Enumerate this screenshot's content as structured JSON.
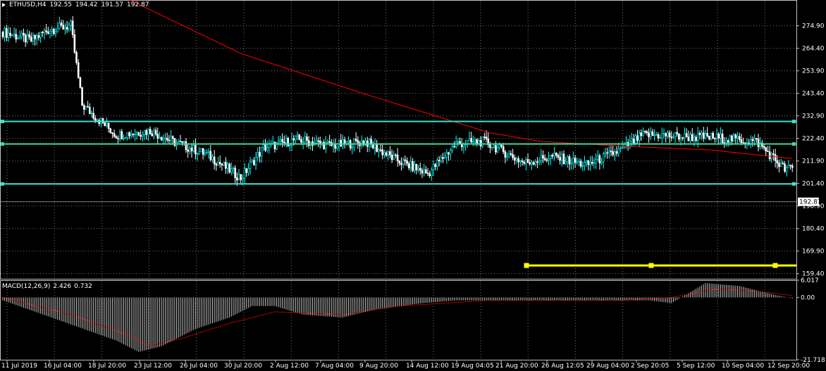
{
  "header": {
    "symbol": "ETHUSD,H4",
    "open": "192.55",
    "high": "194.42",
    "low": "191.57",
    "close": "192.87"
  },
  "macd_header": {
    "name": "MACD(12,26,9)",
    "main": "2.426",
    "signal": "0.732"
  },
  "colors": {
    "background": "#000000",
    "grid": "#c0c0c0",
    "bull_candle": "#00ffff",
    "bear_candle": "#ffffff",
    "moving_average": "#ff0000",
    "support_line": "#ffff00",
    "level_line_cyan": "#40e0d0",
    "level_line_green": "#3cd99a",
    "macd_histogram": "#c0c0c0",
    "macd_signal": "#ff0000"
  },
  "chart_data": [
    {
      "type": "candlestick",
      "title": "ETHUSD,H4",
      "price_axis_ticks": [
        "274.90",
        "264.40",
        "253.90",
        "243.40",
        "232.90",
        "222.40",
        "211.90",
        "201.40",
        "190.90",
        "180.40",
        "169.90",
        "159.40"
      ],
      "ylim": [
        157.0,
        281.0
      ],
      "current_price": "192.87",
      "horizontal_levels": [
        230.3,
        219.8,
        201.2
      ],
      "support_line": 163.2,
      "time_labels": [
        "11 Jul 2019",
        "16 Jul 04:00",
        "18 Jul 20:00",
        "23 Jul 12:00",
        "26 Jul 04:00",
        "30 Jul 20:00",
        "2 Aug 12:00",
        "7 Aug 04:00",
        "9 Aug 20:00",
        "14 Aug 12:00",
        "19 Aug 04:05",
        "21 Aug 20:00",
        "26 Aug 12:05",
        "29 Aug 04:00",
        "2 Sep 20:05",
        "5 Sep 12:00",
        "10 Sep 04:00",
        "12 Sep 20:00"
      ],
      "close_path": [
        [
          0,
          272
        ],
        [
          5,
          268
        ],
        [
          8,
          273
        ],
        [
          12,
          275
        ],
        [
          14,
          238
        ],
        [
          20,
          224
        ],
        [
          26,
          226
        ],
        [
          30,
          221
        ],
        [
          36,
          215
        ],
        [
          42,
          204
        ],
        [
          46,
          218
        ],
        [
          52,
          222
        ],
        [
          58,
          219
        ],
        [
          64,
          221
        ],
        [
          69,
          213
        ],
        [
          75,
          206
        ],
        [
          80,
          220
        ],
        [
          85,
          221
        ],
        [
          92,
          211
        ],
        [
          97,
          214
        ],
        [
          103,
          210
        ],
        [
          109,
          217
        ],
        [
          113,
          224
        ],
        [
          116,
          224
        ],
        [
          121,
          223
        ],
        [
          125,
          223
        ],
        [
          133,
          221
        ],
        [
          138,
          208
        ],
        [
          144,
          211
        ],
        [
          147,
          216
        ],
        [
          153,
          212
        ],
        [
          158,
          217
        ],
        [
          163,
          221
        ],
        [
          171,
          221
        ],
        [
          175,
          233
        ],
        [
          180,
          228
        ],
        [
          186,
          227
        ],
        [
          192,
          223
        ],
        [
          196,
          222
        ],
        [
          198,
          214
        ],
        [
          204,
          210
        ],
        [
          208,
          211
        ],
        [
          211,
          206
        ],
        [
          217,
          202
        ],
        [
          220,
          186
        ],
        [
          223,
          182
        ],
        [
          227,
          185
        ],
        [
          232,
          183
        ],
        [
          236,
          204
        ],
        [
          241,
          203
        ],
        [
          244,
          198
        ],
        [
          248,
          188
        ],
        [
          251,
          193
        ],
        [
          255,
          194
        ],
        [
          260,
          190
        ],
        [
          265,
          185
        ],
        [
          269,
          182
        ],
        [
          272,
          168
        ],
        [
          277,
          166
        ],
        [
          282,
          167
        ],
        [
          285,
          172
        ],
        [
          289,
          177
        ],
        [
          291,
          176
        ],
        [
          297,
          174
        ],
        [
          301,
          171
        ],
        [
          304,
          169
        ],
        [
          311,
          175
        ],
        [
          314,
          176
        ],
        [
          318,
          177
        ],
        [
          324,
          180
        ],
        [
          327,
          181
        ],
        [
          334,
          178
        ],
        [
          336,
          177
        ],
        [
          342,
          176
        ],
        [
          346,
          177
        ],
        [
          349,
          177
        ],
        [
          356,
          177
        ],
        [
          358,
          181
        ],
        [
          363,
          183
        ],
        [
          368,
          187
        ]
      ],
      "moving_average_path": [
        [
          20,
          290
        ],
        [
          42,
          262
        ],
        [
          64,
          243
        ],
        [
          86,
          225
        ],
        [
          95,
          221
        ],
        [
          108,
          219
        ],
        [
          125,
          217
        ],
        [
          150,
          210
        ],
        [
          170,
          200
        ],
        [
          190,
          187
        ],
        [
          210,
          182
        ],
        [
          230,
          180
        ],
        [
          250,
          179
        ],
        [
          270,
          179
        ],
        [
          290,
          179
        ],
        [
          310,
          179
        ],
        [
          330,
          179
        ],
        [
          350,
          178
        ],
        [
          368,
          178
        ]
      ],
      "price_ref_bull": "cyan candles",
      "price_ref_bear": "white candles"
    },
    {
      "type": "bar",
      "title": "MACD(12,26,9)",
      "ticks": [
        "6.017",
        "0.00",
        "-21.718"
      ],
      "ylim": [
        -21.718,
        6.017
      ],
      "main": 2.426,
      "signal": 0.732,
      "histogram_path": [
        [
          0,
          -1
        ],
        [
          10,
          -8
        ],
        [
          20,
          -15
        ],
        [
          24,
          -19
        ],
        [
          28,
          -17
        ],
        [
          34,
          -11
        ],
        [
          40,
          -7
        ],
        [
          44,
          -3
        ],
        [
          48,
          -3
        ],
        [
          53,
          -6
        ],
        [
          60,
          -7
        ],
        [
          66,
          -4
        ],
        [
          74,
          -2
        ],
        [
          80,
          -1
        ],
        [
          86,
          -1
        ],
        [
          90,
          -1
        ],
        [
          96,
          -1
        ],
        [
          101,
          -1
        ],
        [
          108,
          -1
        ],
        [
          114,
          -1
        ],
        [
          118,
          -2
        ],
        [
          124,
          5
        ],
        [
          130,
          4
        ],
        [
          136,
          1
        ],
        [
          141,
          -1
        ],
        [
          150,
          -2
        ],
        [
          156,
          -3
        ],
        [
          166,
          -5
        ],
        [
          170,
          -6
        ],
        [
          175,
          -4
        ],
        [
          180,
          -5
        ],
        [
          186,
          -3
        ],
        [
          190,
          -4
        ],
        [
          194,
          -3
        ],
        [
          198,
          -3
        ],
        [
          204,
          -1
        ],
        [
          208,
          -1
        ],
        [
          212,
          -1
        ],
        [
          218,
          -1
        ],
        [
          224,
          -2
        ],
        [
          230,
          -3
        ],
        [
          236,
          -4
        ],
        [
          240,
          -3
        ],
        [
          245,
          -4
        ],
        [
          250,
          -5
        ],
        [
          256,
          -2
        ],
        [
          260,
          -1
        ],
        [
          265,
          -1
        ],
        [
          270,
          -3
        ],
        [
          276,
          -4
        ],
        [
          282,
          -2
        ],
        [
          288,
          -1
        ],
        [
          294,
          -2
        ],
        [
          298,
          -1
        ],
        [
          302,
          -3
        ],
        [
          306,
          -4
        ],
        [
          311,
          -3
        ],
        [
          314,
          -1
        ],
        [
          318,
          -1
        ],
        [
          324,
          1
        ],
        [
          330,
          2
        ],
        [
          336,
          1
        ],
        [
          342,
          0
        ],
        [
          348,
          1
        ],
        [
          356,
          0
        ],
        [
          362,
          1
        ],
        [
          366,
          2
        ]
      ],
      "signal_path": [
        [
          0,
          0
        ],
        [
          12,
          -6
        ],
        [
          22,
          -13
        ],
        [
          26,
          -17
        ],
        [
          32,
          -14
        ],
        [
          40,
          -9
        ],
        [
          48,
          -5
        ],
        [
          60,
          -6
        ],
        [
          70,
          -3
        ],
        [
          86,
          -1
        ],
        [
          110,
          -1
        ],
        [
          118,
          0
        ],
        [
          126,
          3
        ],
        [
          134,
          2
        ],
        [
          142,
          0
        ],
        [
          160,
          -3
        ],
        [
          172,
          -5
        ],
        [
          186,
          -4
        ],
        [
          200,
          -2
        ],
        [
          220,
          -1
        ],
        [
          240,
          -3
        ],
        [
          256,
          -2
        ],
        [
          270,
          -2
        ],
        [
          290,
          -2
        ],
        [
          310,
          -2
        ],
        [
          320,
          -1
        ],
        [
          334,
          1
        ],
        [
          350,
          1
        ],
        [
          366,
          1
        ]
      ]
    }
  ]
}
